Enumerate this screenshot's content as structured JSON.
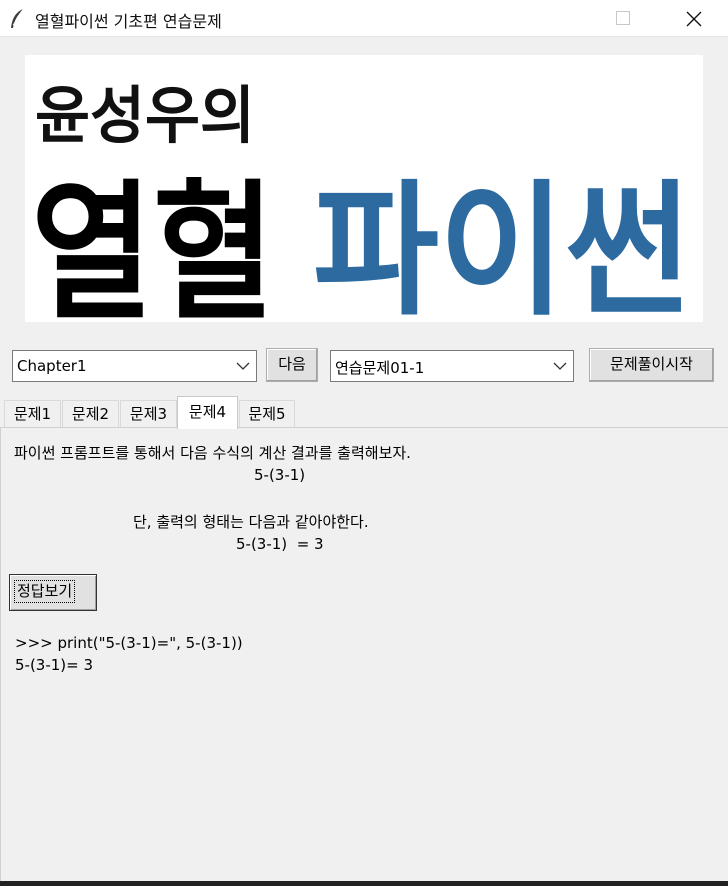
{
  "window": {
    "title": "열혈파이썬 기초편 연습문제"
  },
  "banner": {
    "line1": "윤성우의",
    "line2_black": "열혈",
    "line2_blue": "파이썬",
    "colors": {
      "black": "#000000",
      "blue": "#2c6aa0"
    }
  },
  "controls": {
    "chapter_select": "Chapter1",
    "next_button": "다음",
    "problem_select": "연습문제01-1",
    "start_button": "문제풀이시작"
  },
  "tabs": [
    {
      "label": "문제1",
      "active": false
    },
    {
      "label": "문제2",
      "active": false
    },
    {
      "label": "문제3",
      "active": false
    },
    {
      "label": "문제4",
      "active": true
    },
    {
      "label": "문제5",
      "active": false
    }
  ],
  "problem": {
    "line1": "파이썬 프롬프트를 통해서 다음 수식의 계산 결과를 출력해보자.",
    "line2": "5-(3-1)",
    "line3": "단, 출력의 형태는 다음과 같아야한다.",
    "line4": "5-(3-1)  = 3"
  },
  "answer_button": "정답보기",
  "answer": {
    "line1": ">>> print(\"5-(3-1)=\", 5-(3-1))",
    "line2": "5-(3-1)= 3"
  }
}
